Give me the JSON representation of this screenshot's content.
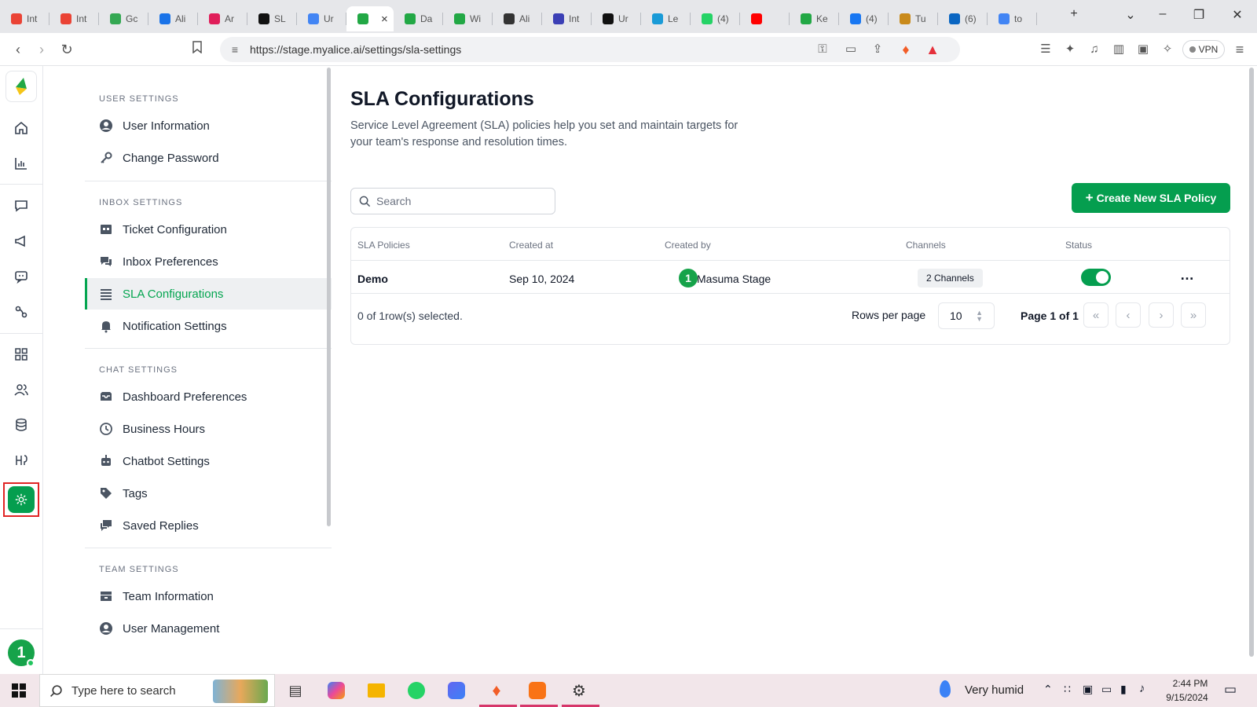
{
  "browser": {
    "tabs": [
      {
        "label": "Int",
        "color": "#ea4335"
      },
      {
        "label": "Int",
        "color": "#ea4335"
      },
      {
        "label": "Gc",
        "color": "#34a853"
      },
      {
        "label": "Ali",
        "color": "#1a73e8"
      },
      {
        "label": "Ar",
        "color": "#e01e5a"
      },
      {
        "label": "SL",
        "color": "#111111"
      },
      {
        "label": "Ur",
        "color": "#4285f4"
      },
      {
        "label": "",
        "color": "#22a845",
        "active": true
      },
      {
        "label": "Da",
        "color": "#22a845"
      },
      {
        "label": "Wi",
        "color": "#22a845"
      },
      {
        "label": "Ali",
        "color": "#333333"
      },
      {
        "label": "Int",
        "color": "#3b3fb5"
      },
      {
        "label": "Ur",
        "color": "#111111"
      },
      {
        "label": "Le",
        "color": "#1a9bd7"
      },
      {
        "label": "(4)",
        "color": "#25d366"
      },
      {
        "label": "",
        "color": "#ff0000"
      },
      {
        "label": "Ke",
        "color": "#22a845"
      },
      {
        "label": "(4)",
        "color": "#1877f2"
      },
      {
        "label": "Tu",
        "color": "#c98a1b"
      },
      {
        "label": "(6)",
        "color": "#0a66c2"
      },
      {
        "label": "to",
        "color": "#4285f4"
      }
    ],
    "url": "https://stage.myalice.ai/settings/sla-settings",
    "vpn_label": "VPN"
  },
  "sidebar": {
    "avatar_number": "1"
  },
  "settings_nav": {
    "sections": [
      {
        "title": "USER SETTINGS",
        "items": [
          {
            "label": "User Information",
            "icon": "user-circle-icon"
          },
          {
            "label": "Change Password",
            "icon": "key-icon"
          }
        ]
      },
      {
        "title": "INBOX SETTINGS",
        "items": [
          {
            "label": "Ticket Configuration",
            "icon": "ticket-icon"
          },
          {
            "label": "Inbox Preferences",
            "icon": "chat-bubbles-icon"
          },
          {
            "label": "SLA Configurations",
            "icon": "list-icon",
            "active": true
          },
          {
            "label": "Notification Settings",
            "icon": "bell-icon"
          }
        ]
      },
      {
        "title": "CHAT SETTINGS",
        "items": [
          {
            "label": "Dashboard Preferences",
            "icon": "inbox-tray-icon"
          },
          {
            "label": "Business Hours",
            "icon": "clock-icon"
          },
          {
            "label": "Chatbot Settings",
            "icon": "robot-icon"
          },
          {
            "label": "Tags",
            "icon": "tag-icon"
          },
          {
            "label": "Saved Replies",
            "icon": "saved-replies-icon"
          }
        ]
      },
      {
        "title": "TEAM SETTINGS",
        "items": [
          {
            "label": "Team Information",
            "icon": "team-icon"
          },
          {
            "label": "User Management",
            "icon": "user-circle-icon"
          }
        ]
      }
    ]
  },
  "main": {
    "title": "SLA Configurations",
    "description": "Service Level Agreement (SLA) policies help you set and maintain targets for your team's response and resolution times.",
    "search_placeholder": "Search",
    "create_button": "Create New SLA Policy",
    "table": {
      "columns": [
        "SLA Policies",
        "Created at",
        "Created by",
        "Channels",
        "Status"
      ],
      "rows": [
        {
          "policy": "Demo",
          "created_at": "Sep 10, 2024",
          "created_by": "Masuma Stage",
          "creator_avatar": "1",
          "channels": "2 Channels",
          "status_on": true
        }
      ],
      "selection_text": "0 of 1row(s) selected.",
      "rows_per_page_label": "Rows per page",
      "rows_per_page_value": "10",
      "page_info": "Page 1 of 1"
    }
  },
  "taskbar": {
    "search_placeholder": "Type here to search",
    "weather": "Very humid",
    "time": "2:44 PM",
    "date": "9/15/2024"
  },
  "colors": {
    "accent_green": "#059e4f",
    "active_nav_bg": "#eef0f2"
  }
}
